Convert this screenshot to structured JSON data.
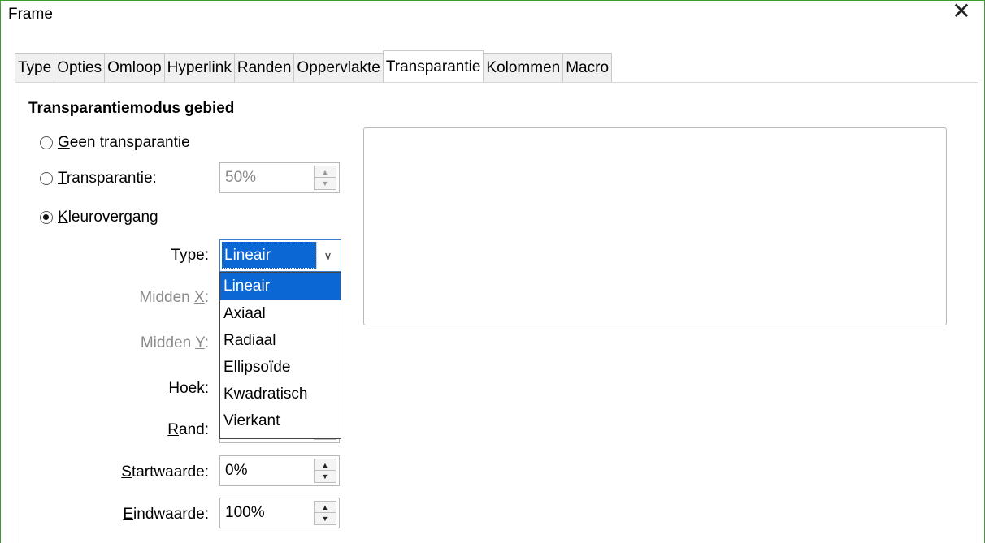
{
  "window": {
    "title": "Frame",
    "close_glyph": "✕"
  },
  "tabs": [
    {
      "label": "Type"
    },
    {
      "label": "Opties"
    },
    {
      "label": "Omloop"
    },
    {
      "label": "Hyperlink"
    },
    {
      "label": "Randen"
    },
    {
      "label": "Oppervlakte"
    },
    {
      "label": "Transparantie",
      "active": true
    },
    {
      "label": "Kolommen"
    },
    {
      "label": "Macro"
    }
  ],
  "section": {
    "title": "Transparantiemodus gebied"
  },
  "modes": {
    "none": {
      "first": "G",
      "rest": "een transparantie",
      "checked": false
    },
    "transparency": {
      "first": "T",
      "rest": "ransparantie:",
      "checked": false,
      "value": "50%"
    },
    "gradient": {
      "first": "K",
      "rest": "leurovergang",
      "checked": true
    }
  },
  "gradient": {
    "type_label_pre": "Ty",
    "type_label_u": "p",
    "type_label_post": "e:",
    "type_value": "Lineair",
    "type_options": [
      "Lineair",
      "Axiaal",
      "Radiaal",
      "Ellipsoïde",
      "Kwadratisch",
      "Vierkant"
    ],
    "highlighted_option": "Lineair",
    "center_x_pre": "Midden ",
    "center_x_u": "X",
    "center_x_post": ":",
    "center_y_pre": "Midden ",
    "center_y_u": "Y",
    "center_y_post": ":",
    "angle_u": "H",
    "angle_rest": "oek:",
    "border_u": "R",
    "border_rest": "and:",
    "start_u": "S",
    "start_rest": "tartwaarde:",
    "start_value": "0%",
    "end_u": "E",
    "end_rest": "indwaarde:",
    "end_value": "100%"
  },
  "icons": {
    "spin_up": "▲",
    "spin_down": "▼",
    "dropdown": "∨"
  }
}
